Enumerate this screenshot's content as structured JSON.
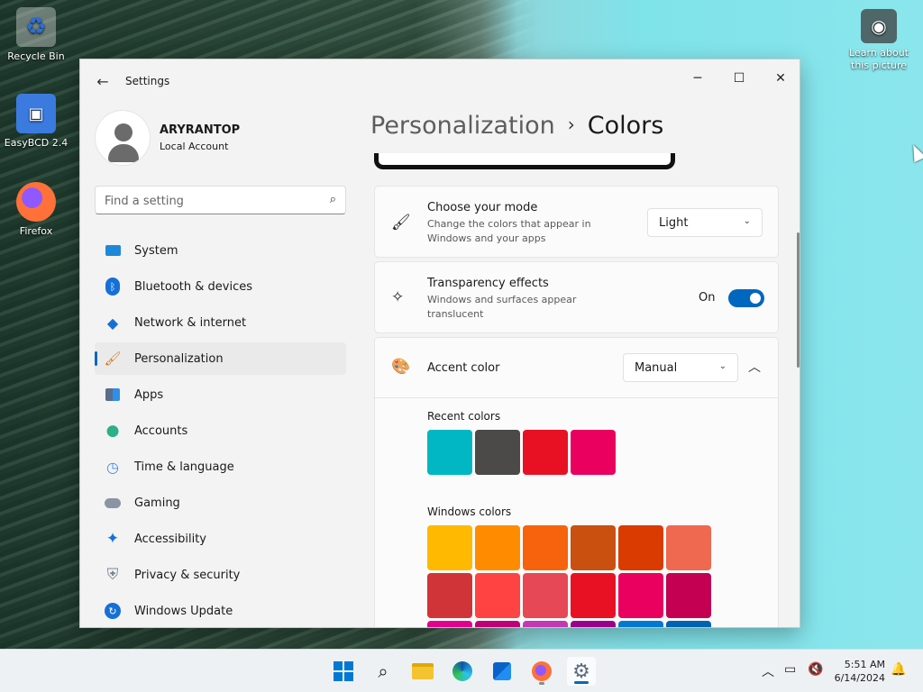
{
  "desktop": {
    "icons": [
      {
        "label": "Recycle Bin"
      },
      {
        "label": "EasyBCD 2.4"
      },
      {
        "label": "Firefox"
      },
      {
        "label": "Learn about this picture"
      }
    ]
  },
  "window": {
    "title": "Settings",
    "controls": {
      "minimize": "─",
      "maximize": "☐",
      "close": "✕"
    }
  },
  "profile": {
    "name": "ARYRANTOP",
    "account_type": "Local Account"
  },
  "search": {
    "placeholder": "Find a setting"
  },
  "sidebar": {
    "items": [
      {
        "label": "System",
        "icon": "monitor-icon"
      },
      {
        "label": "Bluetooth & devices",
        "icon": "bluetooth-icon"
      },
      {
        "label": "Network & internet",
        "icon": "wifi-icon"
      },
      {
        "label": "Personalization",
        "icon": "brush-icon",
        "active": true
      },
      {
        "label": "Apps",
        "icon": "apps-icon"
      },
      {
        "label": "Accounts",
        "icon": "person-icon"
      },
      {
        "label": "Time & language",
        "icon": "clock-globe-icon"
      },
      {
        "label": "Gaming",
        "icon": "gamepad-icon"
      },
      {
        "label": "Accessibility",
        "icon": "accessibility-icon"
      },
      {
        "label": "Privacy & security",
        "icon": "shield-icon"
      },
      {
        "label": "Windows Update",
        "icon": "update-icon"
      }
    ]
  },
  "header": {
    "parent": "Personalization",
    "separator": "›",
    "current": "Colors"
  },
  "mode": {
    "title": "Choose your mode",
    "description": "Change the colors that appear in Windows and your apps",
    "value": "Light"
  },
  "transparency": {
    "title": "Transparency effects",
    "description": "Windows and surfaces appear translucent",
    "state_label": "On",
    "enabled": true
  },
  "accent": {
    "title": "Accent color",
    "value": "Manual",
    "recent_label": "Recent colors",
    "recent_colors": [
      "#00b7c3",
      "#4c4a48",
      "#e81123",
      "#ea005e"
    ],
    "windows_label": "Windows colors",
    "windows_colors": [
      [
        "#ffb900",
        "#ff8c00",
        "#f7630c",
        "#ca5010",
        "#da3b01",
        "#ef6950"
      ],
      [
        "#d13438",
        "#ff4343",
        "#e74856",
        "#e81123",
        "#ea005e",
        "#c30052"
      ],
      [
        "#e3008c",
        "#bf0077",
        "#c239b3",
        "#9a0089",
        "#0078d4",
        "#0063b1"
      ]
    ]
  },
  "taskbar": {
    "apps": [
      {
        "name": "start-icon"
      },
      {
        "name": "search-icon"
      },
      {
        "name": "file-explorer-icon"
      },
      {
        "name": "edge-icon"
      },
      {
        "name": "store-icon"
      },
      {
        "name": "firefox-icon"
      },
      {
        "name": "settings-icon"
      }
    ],
    "clock": {
      "time": "5:51 AM",
      "date": "6/14/2024"
    }
  }
}
